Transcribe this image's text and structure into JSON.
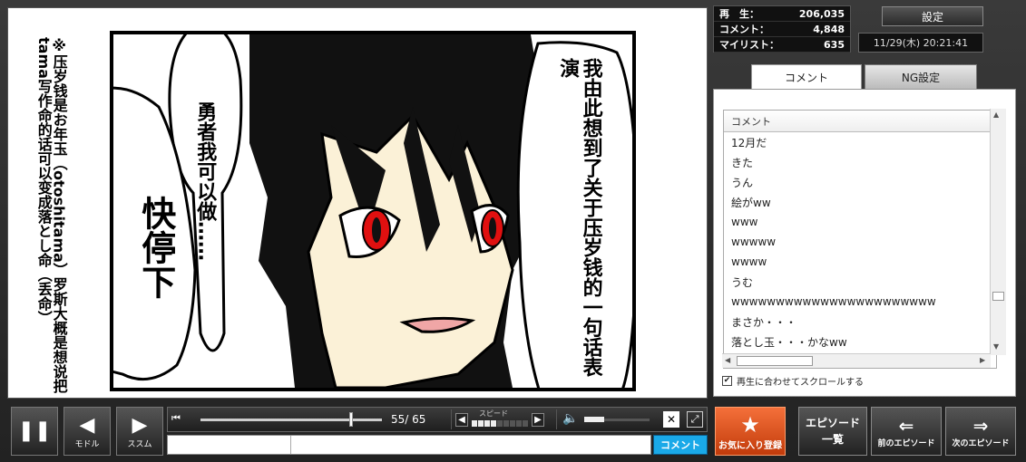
{
  "stats": {
    "views_label": "再　生：",
    "views_value": "206,035",
    "comments_label": "コメント：",
    "comments_value": "4,848",
    "mylist_label": "マイリスト：",
    "mylist_value": "635"
  },
  "header": {
    "settings_label": "設定",
    "datetime": "11/29(木) 20:21:41"
  },
  "manga": {
    "bubble_right": "我由此想到了关于压岁钱的一句话表演",
    "bubble_left": "勇者我可以做……",
    "bubble_big": "快停下",
    "note": "※压岁钱是お年玉（otoshitama）罗斯大概是想说把tama写作命的话可以变成落とし命（丢命）"
  },
  "tabs": {
    "comment": "コメント",
    "ng": "NG設定"
  },
  "comments": {
    "header": "コメント",
    "items": [
      "12月だ",
      "きた",
      "うん",
      "絵がww",
      "www",
      "wwwww",
      "wwww",
      "うむ",
      "wwwwwwwwwwwwwwwwwwwwwww",
      "まさか・・・",
      "落とし玉・・・かなww"
    ],
    "sync_label": "再生に合わせてスクロールする"
  },
  "controls": {
    "pause_icon": "❚❚",
    "back_label": "モドル",
    "back_icon": "◀",
    "forward_label": "ススム",
    "forward_icon": "▶",
    "seek_start_icon": "⏮",
    "page_counter": "55/ 65",
    "speed_label": "スピード",
    "speed_down": "◀",
    "speed_up": "▶",
    "volume_icon": "🔈",
    "mute_icon": "✕",
    "fullscreen_icon": "⤢",
    "comment_submit": "コメント"
  },
  "episode": {
    "favorite_label": "お気に入り登録",
    "favorite_icon": "★",
    "list_label": "エピソード一覧",
    "prev_label": "前のエピソード",
    "prev_icon": "⇐",
    "next_label": "次のエピソード",
    "next_icon": "⇒"
  },
  "colors": {
    "accent_orange": "#e2561e",
    "comment_blue": "#1aa9e8",
    "eye_red": "#e01010",
    "skin": "#fbf1d7"
  }
}
